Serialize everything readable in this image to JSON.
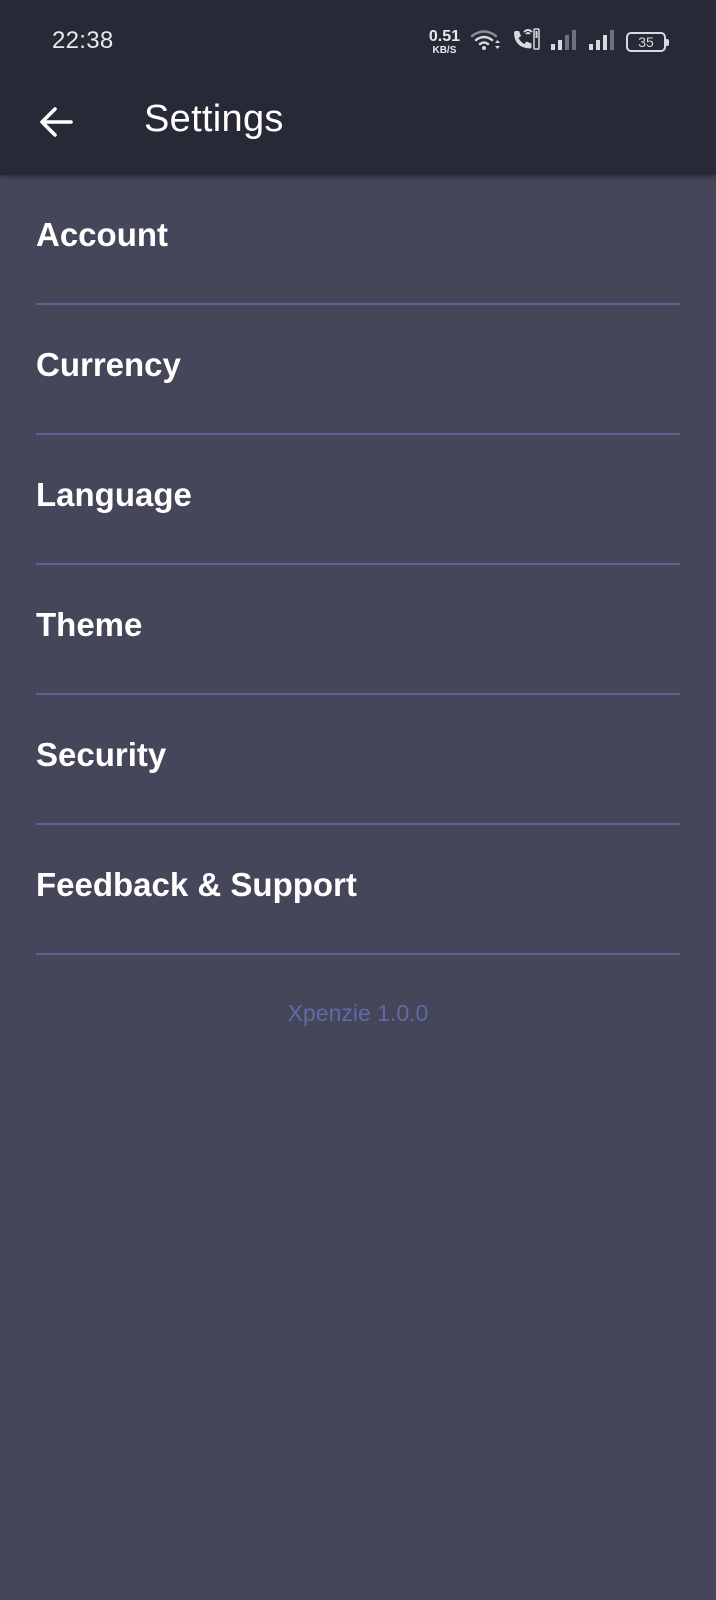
{
  "status_bar": {
    "time": "22:38",
    "net_speed_value": "0.51",
    "net_speed_unit": "KB/S",
    "battery_level": "35",
    "icons": [
      "wifi-icon",
      "volte-call-icon",
      "signal-icon-sim1",
      "signal-icon-sim2",
      "battery-icon"
    ]
  },
  "app_bar": {
    "title": "Settings",
    "back_icon": "arrow-left-icon"
  },
  "settings": {
    "items": [
      {
        "label": "Account"
      },
      {
        "label": "Currency"
      },
      {
        "label": "Language"
      },
      {
        "label": "Theme"
      },
      {
        "label": "Security"
      },
      {
        "label": "Feedback & Support"
      }
    ]
  },
  "footer": {
    "version": "Xpenzie 1.0.0"
  },
  "colors": {
    "background": "#454659",
    "app_bar": "#272936",
    "divider": "#5c6496",
    "version_text": "#5f6aa6",
    "text": "#ffffff"
  }
}
